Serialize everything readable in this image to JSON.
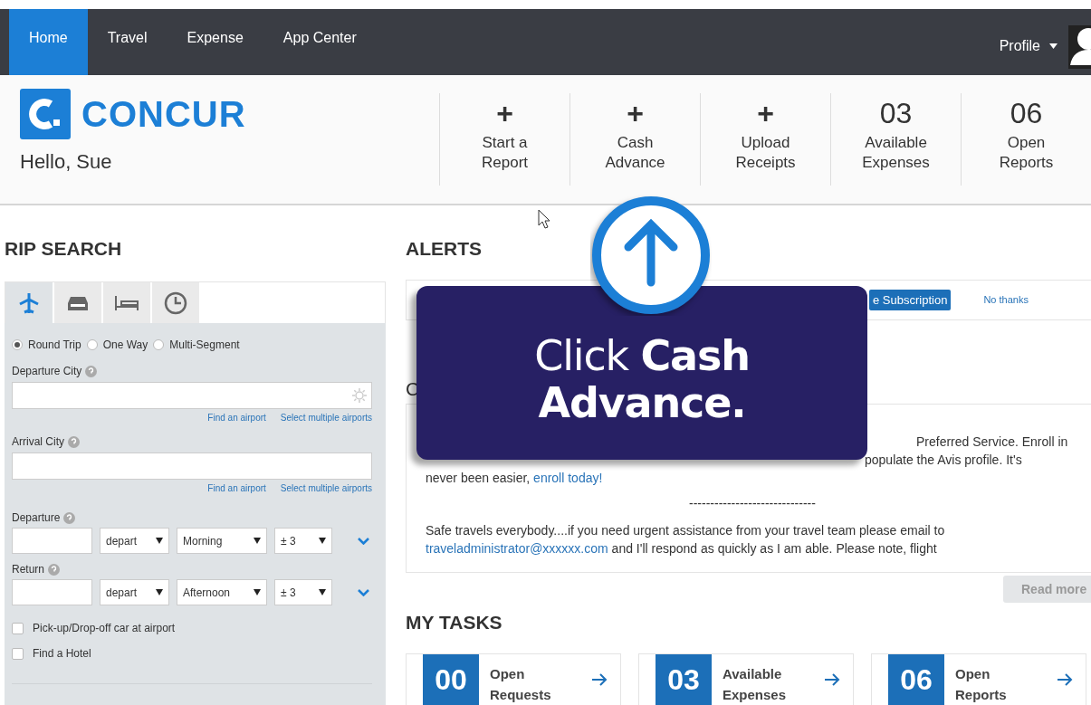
{
  "nav": {
    "tabs": [
      {
        "label": "Home",
        "selected": true
      },
      {
        "label": "Travel",
        "selected": false
      },
      {
        "label": "Expense",
        "selected": false
      },
      {
        "label": "App Center",
        "selected": false
      }
    ],
    "profile": "Profile"
  },
  "header": {
    "brand": "CONCUR",
    "greeting": "Hello, Sue",
    "actions": [
      {
        "kind": "add",
        "icon": "+",
        "label": "Start a Report"
      },
      {
        "kind": "add",
        "icon": "+",
        "label": "Cash Advance"
      },
      {
        "kind": "add",
        "icon": "+",
        "label": "Upload Receipts"
      },
      {
        "kind": "count",
        "icon": "03",
        "label": "Available Expenses"
      },
      {
        "kind": "count",
        "icon": "06",
        "label": "Open Reports"
      }
    ]
  },
  "trip_search": {
    "title": "RIP SEARCH",
    "tabs": [
      {
        "kind": "flight",
        "selected": true
      },
      {
        "kind": "car",
        "selected": false
      },
      {
        "kind": "hotel",
        "selected": false
      },
      {
        "kind": "history",
        "selected": false
      }
    ],
    "trip_types": [
      {
        "label": "Round Trip",
        "selected": true
      },
      {
        "label": "One Way",
        "selected": false
      },
      {
        "label": "Multi-Segment",
        "selected": false
      }
    ],
    "cities": [
      {
        "label": "Departure City",
        "gear": true,
        "links": [
          "Find an airport",
          "Select multiple airports"
        ]
      },
      {
        "label": "Arrival City",
        "gear": false,
        "links": [
          "Find an airport",
          "Select multiple airports"
        ]
      }
    ],
    "dates": [
      {
        "label": "Departure",
        "mode": "depart",
        "time": "Morning",
        "window": "± 3"
      },
      {
        "label": "Return",
        "mode": "depart",
        "time": "Afternoon",
        "window": "± 3"
      }
    ],
    "options": [
      {
        "label": "Pick-up/Drop-off car at airport",
        "checked": false
      },
      {
        "label": "Find a Hotel",
        "checked": false
      }
    ]
  },
  "alerts": {
    "title": "ALERTS",
    "subscribe": "e Subscription",
    "decline": "No thanks",
    "section_heading": "C",
    "message_lines": [
      "Preferred Service. Enroll in",
      "populate the Avis profile.  It's"
    ],
    "message_end": "never been easier, ",
    "message_link": "enroll today!",
    "separator": "------------------------------",
    "note": "Safe travels everybody....if you need urgent assistance from your travel team please email to",
    "note_email": "traveladministrator@xxxxxx.com",
    "note_rest": " and I'll respond as quickly as I am able.  Please note, flight",
    "read_more": "Read more"
  },
  "tasks": {
    "title": "MY TASKS",
    "items": [
      {
        "count": "00",
        "label": "Open Requests"
      },
      {
        "count": "03",
        "label": "Available Expenses"
      },
      {
        "count": "06",
        "label": "Open Reports"
      }
    ]
  },
  "tour_overlay": {
    "message": "Click **Cash Advance.**"
  }
}
